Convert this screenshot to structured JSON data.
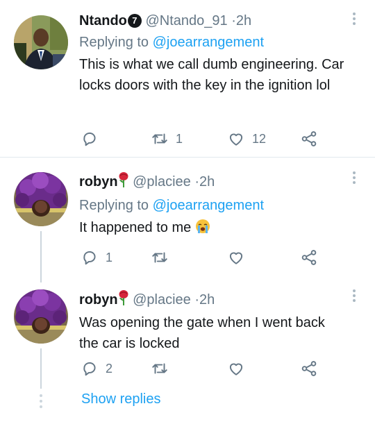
{
  "tweets": [
    {
      "name": "Ntando",
      "badge": "7",
      "handle": "@Ntando_91",
      "separator": "·",
      "time": "2h",
      "replying_prefix": "Replying to",
      "replying_to": "@joearrangement",
      "text": "This is what we call dumb engineering. Car locks doors with the key in the ignition lol",
      "replies": "",
      "retweets": "1",
      "likes": "12"
    },
    {
      "name": "robyn",
      "name_emoji": "rose",
      "handle": "@placiee",
      "separator": "·",
      "time": "2h",
      "replying_prefix": "Replying to",
      "replying_to": "@joearrangement",
      "text": "It happened to me",
      "text_emoji": "loudly-crying-face",
      "replies": "1",
      "retweets": "",
      "likes": ""
    },
    {
      "name": "robyn",
      "name_emoji": "rose",
      "handle": "@placiee",
      "separator": "·",
      "time": "2h",
      "text": "Was opening the gate when I went back the car is locked",
      "replies": "2",
      "retweets": "",
      "likes": ""
    }
  ],
  "show_replies_label": "Show replies",
  "colors": {
    "link": "#1da1f2",
    "muted": "#657786",
    "divider": "#e1e8ed",
    "thread": "#ccd6dd"
  }
}
